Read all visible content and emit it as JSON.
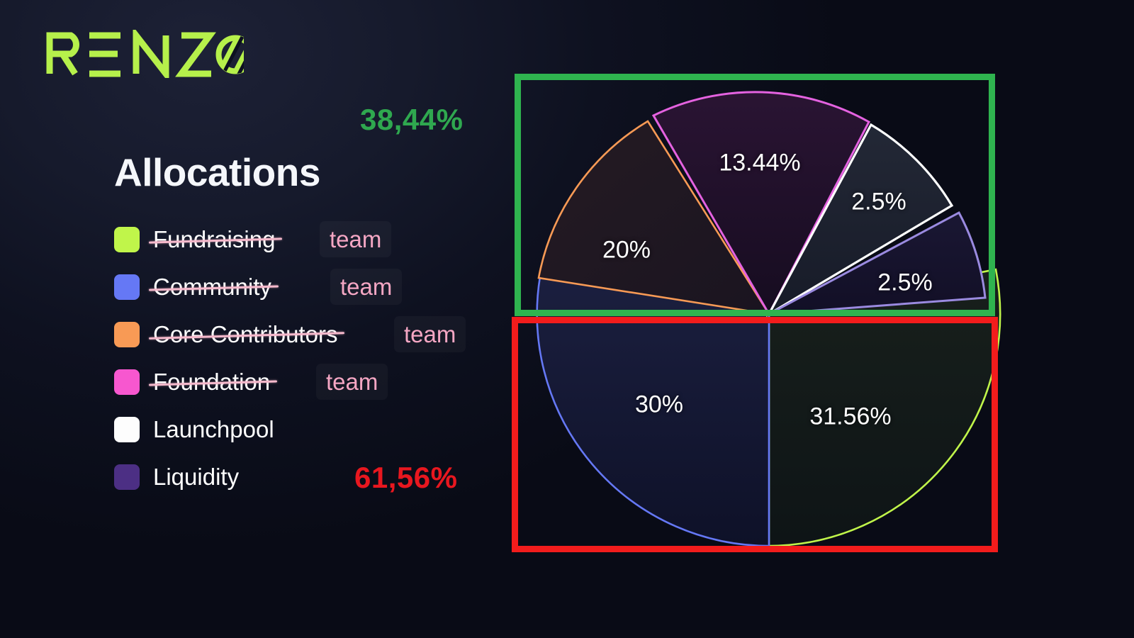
{
  "brand": {
    "name": "RENZO",
    "logo_color": "#b6f04b"
  },
  "heading": {
    "title": "Allocations"
  },
  "legend": {
    "items": [
      {
        "label": "Fundraising",
        "color": "#c0f54a",
        "struck": true,
        "annotation": "team"
      },
      {
        "label": "Community",
        "color": "#6578f5",
        "struck": true,
        "annotation": "team"
      },
      {
        "label": "Core Contributors",
        "color": "#f89a55",
        "struck": true,
        "annotation": "team"
      },
      {
        "label": "Foundation",
        "color": "#f757cf",
        "struck": true,
        "annotation": "team"
      },
      {
        "label": "Launchpool",
        "color": "#fdfdfd",
        "struck": false,
        "annotation": ""
      },
      {
        "label": "Liquidity",
        "color": "#4c2f84",
        "struck": false,
        "annotation": ""
      }
    ]
  },
  "totals": {
    "top_label": "38,44%",
    "top_color": "#2fa84f",
    "bottom_label": "61,56%",
    "bottom_color": "#e8171f"
  },
  "annotations": {
    "green_rect_color": "#2fb44f",
    "red_rect_color": "#f21c1c",
    "strike_color": "#f5b8cb",
    "team_text_color": "#f5a7c4"
  },
  "chart_data": {
    "type": "pie",
    "title": "Allocations",
    "legend_position": "left",
    "grid": false,
    "labels": [
      "Fundraising",
      "Community",
      "Core Contributors",
      "Foundation",
      "Launchpool",
      "Liquidity"
    ],
    "values": [
      31.56,
      30,
      20,
      13.44,
      2.5,
      2.5
    ],
    "value_labels": [
      "31.56%",
      "30%",
      "20%",
      "13.44%",
      "2.5%",
      "2.5%"
    ],
    "colors": [
      "#c0f54a",
      "#6578f5",
      "#f89a55",
      "#f757cf",
      "#fdfdfd",
      "#4c2f84"
    ],
    "groups": [
      {
        "name": "top-half",
        "label": "38,44%",
        "color": "#2fa84f",
        "members": [
          "Core Contributors",
          "Foundation",
          "Launchpool",
          "Liquidity"
        ]
      },
      {
        "name": "bottom-half",
        "label": "61,56%",
        "color": "#e8171f",
        "members": [
          "Fundraising",
          "Community"
        ]
      }
    ]
  }
}
